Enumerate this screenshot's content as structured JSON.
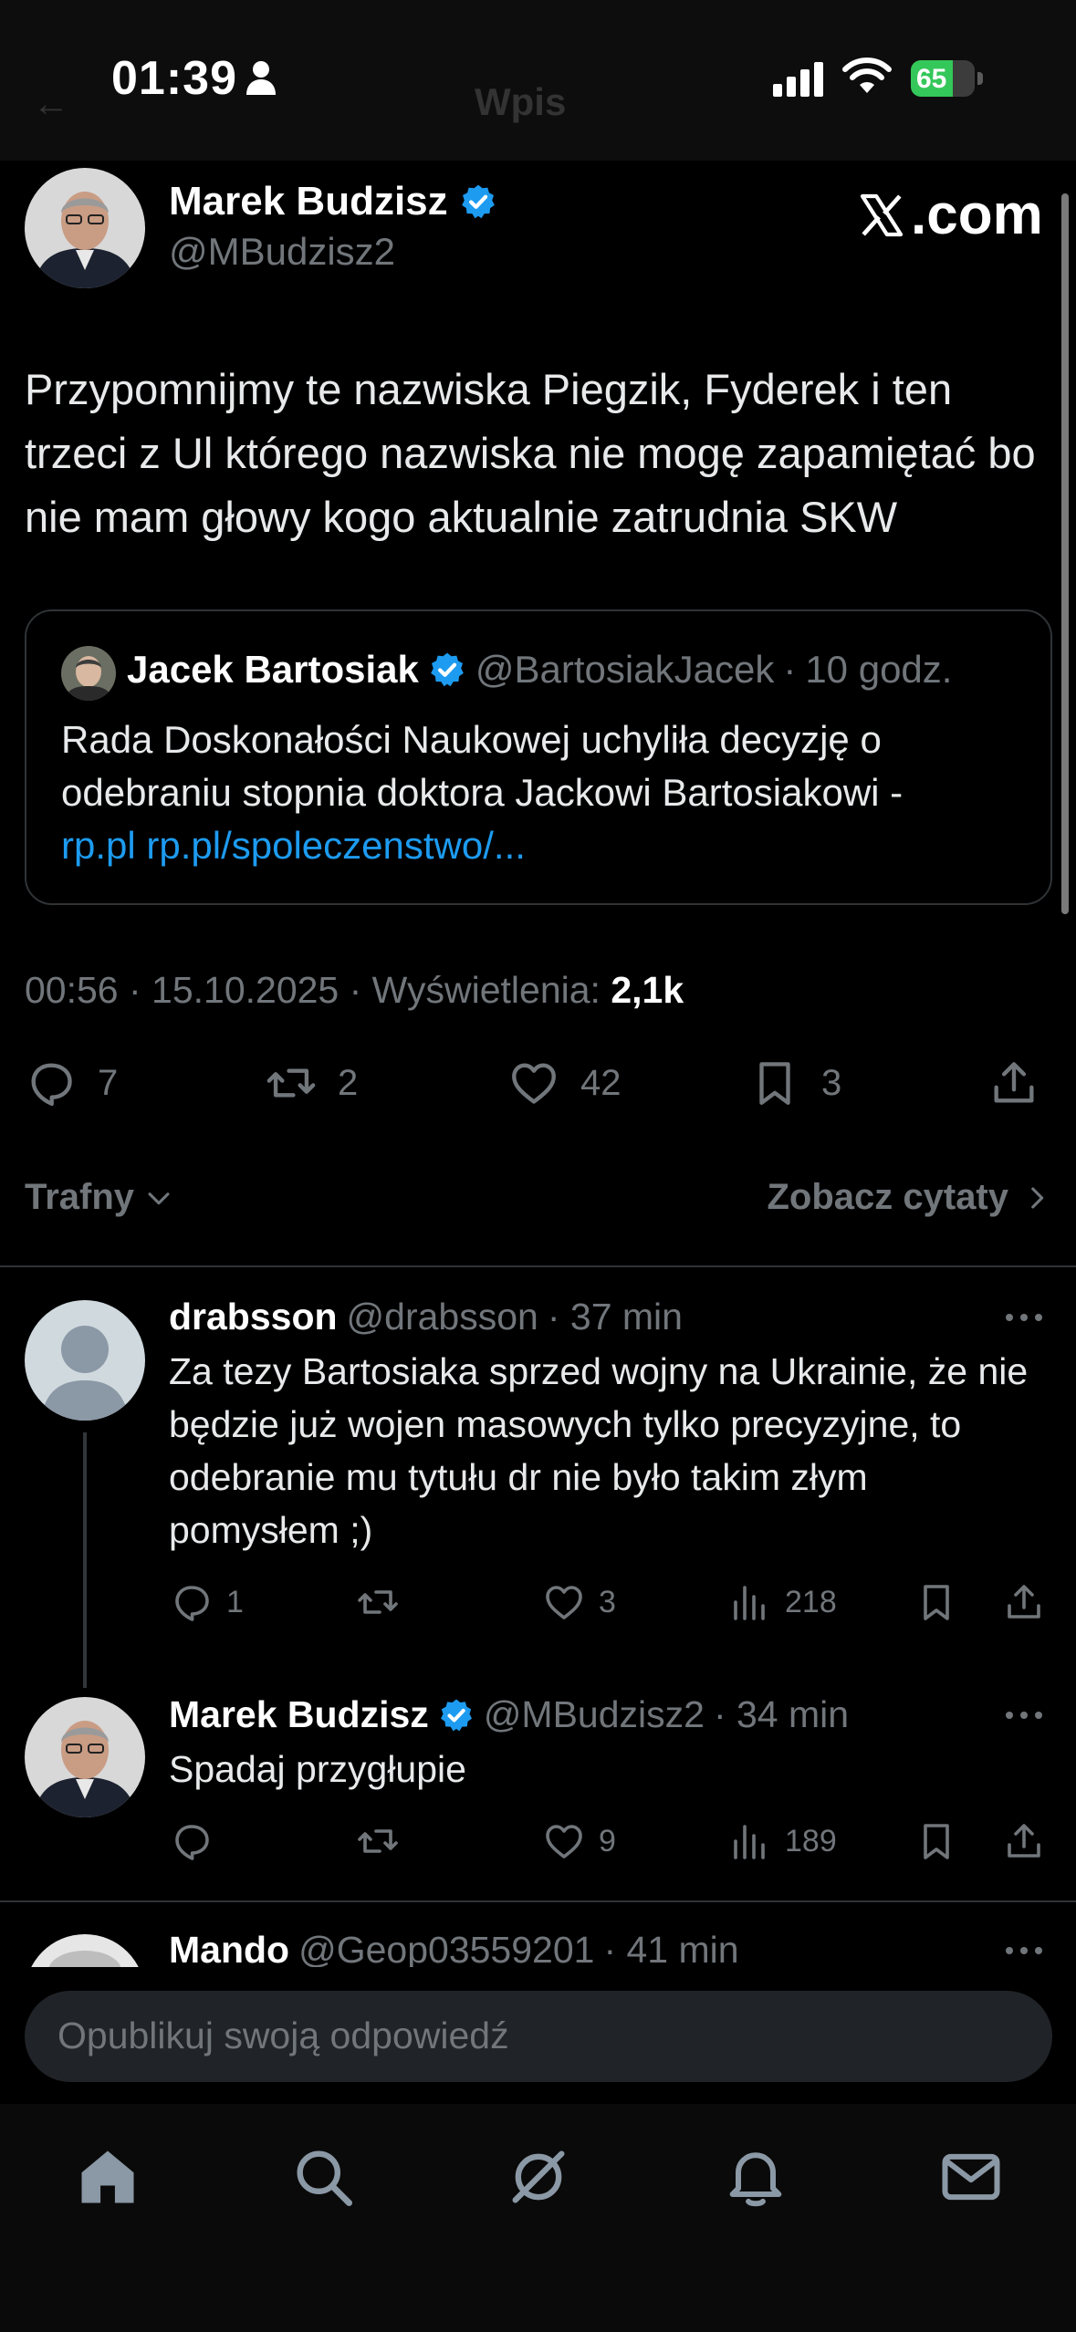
{
  "status_bar": {
    "time": "01:39",
    "battery_level": "65",
    "battery_percent": 65,
    "icons": [
      "person-icon",
      "signal-icon",
      "wifi-icon",
      "battery-charging-icon"
    ]
  },
  "header": {
    "title_faded": "Wpis",
    "back_icon": "arrow-left-icon",
    "brand": ".com"
  },
  "main_post": {
    "author_name": "Marek Budzisz",
    "author_handle": "@MBudzisz2",
    "verified": true,
    "text": "Przypomnijmy te nazwiska Piegzik, Fyderek i ten trzeci z Ul którego nazwiska nie mogę zapamiętać bo nie mam głowy kogo aktualnie zatrudnia SKW",
    "quote": {
      "author_name": "Jacek Bartosiak",
      "author_handle": "@BartosiakJacek",
      "time": "10 godz.",
      "separator": "·",
      "text": "Rada Doskonałości Naukowej uchyliła decyzję o odebraniu stopnia doktora Jackowi Bartosiakowi -",
      "link_text": "rp.pl rp.pl/spoleczenstwo/..."
    },
    "timestamp": "00:56 · 15.10.2025 · Wyświetlenia:",
    "views": "2,1k",
    "stats": {
      "replies": "7",
      "reposts": "2",
      "likes": "42",
      "bookmarks": "3"
    }
  },
  "sort": {
    "left_label": "Trafny",
    "right_label": "Zobacz cytaty"
  },
  "replies": [
    {
      "author_name": "drabsson",
      "author_handle": "@drabsson",
      "time": "· 37 min",
      "text": "Za tezy Bartosiaka sprzed wojny na Ukrainie, że nie będzie już wojen masowych tylko precyzyjne, to odebranie mu tytułu dr nie było takim złym pomysłem ;)",
      "replies": "1",
      "reposts": "",
      "likes": "3",
      "views": "218"
    },
    {
      "author_name": "Marek Budzisz",
      "author_handle": "@MBudzisz2",
      "time": "· 34 min",
      "text": "Spadaj przygłupie",
      "replies": "",
      "reposts": "",
      "likes": "9",
      "views": "189"
    },
    {
      "author_name": "Mando",
      "author_handle": "@Geop03559201",
      "time": "· 41 min"
    }
  ],
  "reply_input": {
    "placeholder": "Opublikuj swoją odpowiedź"
  },
  "tabbar": {
    "icons": [
      "home-icon",
      "search-icon",
      "grok-icon",
      "notifications-icon",
      "messages-icon"
    ]
  },
  "colors": {
    "background": "#000000",
    "text": "#e7e9ea",
    "muted": "#71767b",
    "accent": "#1d9bf0",
    "divider": "#2f3336"
  }
}
